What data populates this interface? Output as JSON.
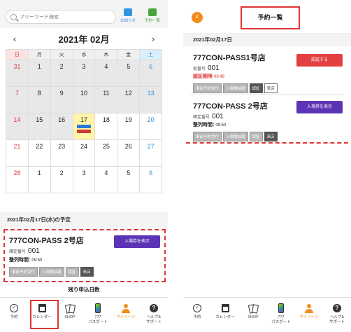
{
  "left": {
    "search": {
      "placeholder": "フリーワード検索"
    },
    "header_buttons": {
      "notice": "お知らせ",
      "reserve_list": "予約一覧"
    },
    "calendar": {
      "prev": "‹",
      "next": "›",
      "month": "2021年 02月",
      "weekdays": [
        "日",
        "月",
        "火",
        "水",
        "木",
        "金",
        "土"
      ],
      "weeks": [
        [
          "31",
          "1",
          "2",
          "3",
          "4",
          "5",
          "6"
        ],
        [
          "7",
          "8",
          "9",
          "10",
          "11",
          "12",
          "13"
        ],
        [
          "14",
          "15",
          "16",
          "17",
          "18",
          "19",
          "20"
        ],
        [
          "21",
          "22",
          "23",
          "24",
          "25",
          "26",
          "27"
        ],
        [
          "28",
          "1",
          "2",
          "3",
          "4",
          "5",
          "6"
        ]
      ],
      "tags_on_17": [
        "000",
        "000"
      ]
    },
    "schedule_label": "2021年02月17日(水)の予定",
    "reservation": {
      "store": "777CON-PASS 2号店",
      "code_label": "確定番号",
      "code": "001",
      "time_label": "整列時間:",
      "time": "09:50",
      "ticket_button": "入場券を表示",
      "steps": [
        "事前予約受付",
        "入場権抽選",
        "認証",
        "来店"
      ]
    },
    "remaining": "残り申込日数",
    "tabs": [
      {
        "icon": "check-icon",
        "label": "予約"
      },
      {
        "icon": "calendar-icon",
        "label": "カレンダー"
      },
      {
        "icon": "shop-icon",
        "label": "SHOP"
      },
      {
        "icon": "phone-icon",
        "label": "777\nパスポート"
      },
      {
        "icon": "person-icon",
        "label": "マイページ"
      },
      {
        "icon": "help-icon",
        "label": "ヘルプ&\nサポート"
      }
    ]
  },
  "right": {
    "title": "予約一覧",
    "back": "‹",
    "date": "2021年02月17日",
    "items": [
      {
        "store": "777CON-PASS1号店",
        "code_label": "仮番号",
        "code": "001",
        "time_label": "認証期限",
        "time": "09:48",
        "button": "認証する",
        "steps": [
          "事前予約受付",
          "入場権抽選",
          "認証",
          "来店"
        ]
      },
      {
        "store": "777CON-PASS 2号店",
        "code_label": "確定番号",
        "code": "001",
        "time_label": "整列時間:",
        "time": "09:50",
        "button": "入場券を表示",
        "steps": [
          "事前予約受付",
          "入場権抽選",
          "認証",
          "来店"
        ]
      }
    ],
    "tabs": [
      {
        "icon": "check-icon",
        "label": "予約"
      },
      {
        "icon": "calendar-icon",
        "label": "カレンダー"
      },
      {
        "icon": "shop-icon",
        "label": "SHOP"
      },
      {
        "icon": "phone-icon",
        "label": "777\nパスポート"
      },
      {
        "icon": "person-icon",
        "label": "マイページ"
      },
      {
        "icon": "help-icon",
        "label": "ヘルプ&\nサポート"
      }
    ]
  }
}
